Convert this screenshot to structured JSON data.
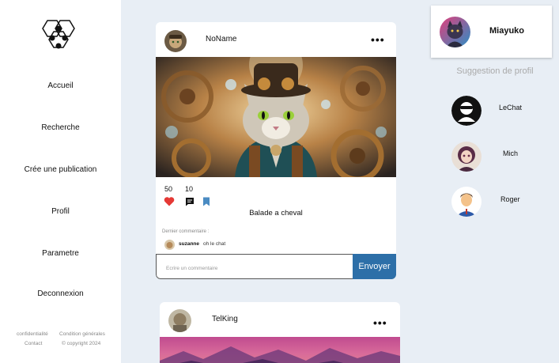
{
  "sidebar": {
    "nav": [
      "Accueil",
      "Recherche",
      "Crée une publication",
      "Profil",
      "Parametre",
      "Deconnexion"
    ],
    "footer": {
      "confidentiality": "confidentialité",
      "conditions": "Condition générales",
      "contact": "Contact",
      "copyright": "© copyright 2024"
    }
  },
  "feed": {
    "post1": {
      "username": "NoName",
      "likes": "50",
      "comments": "10",
      "caption": "Balade a cheval",
      "last_comment_label": "Dernier commentaire :",
      "last_comment_user": "suzanne",
      "last_comment_text": "oh le chat",
      "comment_placeholder": "Ecrire un commentaire",
      "send_label": "Envoyer"
    },
    "post2": {
      "username": "TelKing"
    }
  },
  "profile": {
    "name": "Miayuko"
  },
  "suggestions": {
    "title": "Suggestion de profil",
    "items": [
      "LeChat",
      "Mich",
      "Roger"
    ]
  },
  "colors": {
    "accent": "#2d6fa8",
    "background": "#e8eef5",
    "like": "#e53935",
    "bookmark": "#4a8bc2"
  }
}
